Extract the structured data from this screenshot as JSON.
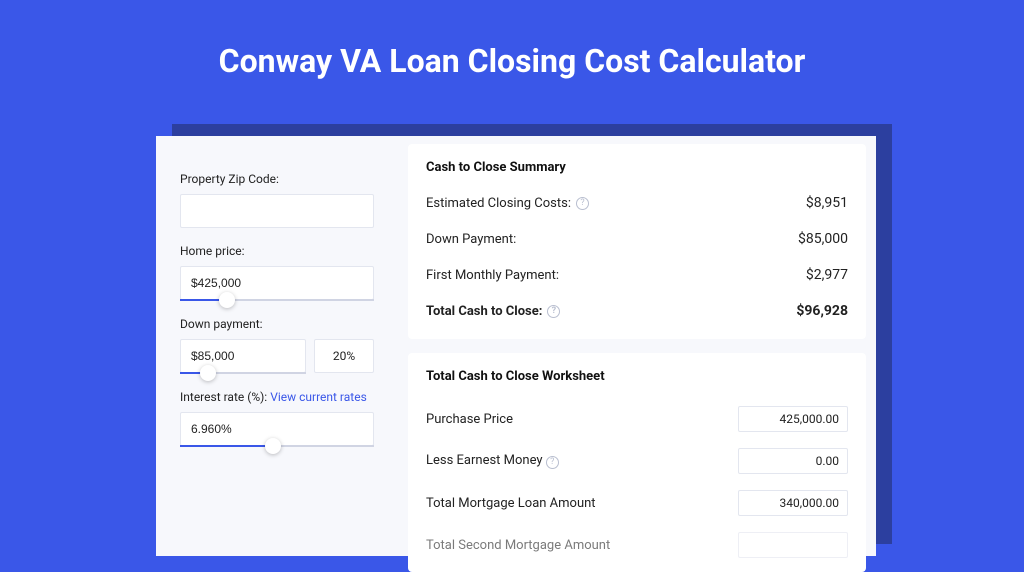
{
  "title": "Conway VA Loan Closing Cost Calculator",
  "inputs": {
    "zip": {
      "label": "Property Zip Code:",
      "value": ""
    },
    "price": {
      "label": "Home price:",
      "value": "$425,000",
      "slider_pct": 24
    },
    "down": {
      "label": "Down payment:",
      "value": "$85,000",
      "pct": "20%",
      "slider_pct": 22
    },
    "rate": {
      "label": "Interest rate (%):",
      "link": "View current rates",
      "value": "6.960%",
      "slider_pct": 48
    }
  },
  "summary": {
    "title": "Cash to Close Summary",
    "rows": [
      {
        "label": "Estimated Closing Costs:",
        "value": "$8,951",
        "help": true
      },
      {
        "label": "Down Payment:",
        "value": "$85,000",
        "help": false
      },
      {
        "label": "First Monthly Payment:",
        "value": "$2,977",
        "help": false
      }
    ],
    "total": {
      "label": "Total Cash to Close:",
      "value": "$96,928",
      "help": true
    }
  },
  "worksheet": {
    "title": "Total Cash to Close Worksheet",
    "rows": [
      {
        "label": "Purchase Price",
        "value": "425,000.00",
        "help": false
      },
      {
        "label": "Less Earnest Money",
        "value": "0.00",
        "help": true
      },
      {
        "label": "Total Mortgage Loan Amount",
        "value": "340,000.00",
        "help": false
      },
      {
        "label": "Total Second Mortgage Amount",
        "value": "",
        "help": false
      }
    ]
  }
}
